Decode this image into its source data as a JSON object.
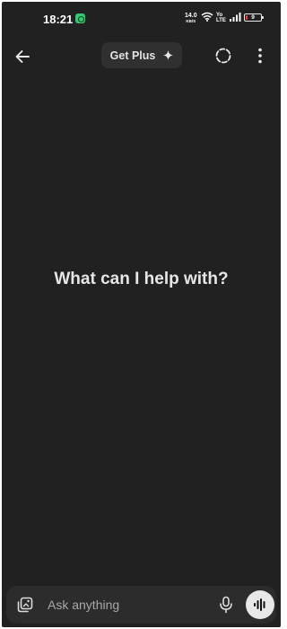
{
  "status_bar": {
    "time": "18:21",
    "net_speed_value": "14.0",
    "net_speed_unit": "KB/S",
    "volte_top": "Yo",
    "volte_bottom": "LTE",
    "battery_level": "9",
    "battery_fraction": 0.09,
    "colors": {
      "battery_low": "#ff3b30",
      "app_notification": "#2ecc71"
    }
  },
  "top_bar": {
    "back_icon": "arrow-left-icon",
    "get_plus_label": "Get Plus",
    "get_plus_icon": "sparkle-icon",
    "temporary_chat_icon": "dashed-circle-icon",
    "more_icon": "vertical-dots-icon"
  },
  "main": {
    "headline": "What can I help with?"
  },
  "composer": {
    "attach_icon": "image-attach-icon",
    "placeholder": "Ask anything",
    "mic_icon": "microphone-icon",
    "voice_icon": "waveform-icon"
  },
  "colors": {
    "background": "#212121",
    "surface": "#303030",
    "composer": "#2c2c2c",
    "voice_button": "#e8e8e8"
  }
}
